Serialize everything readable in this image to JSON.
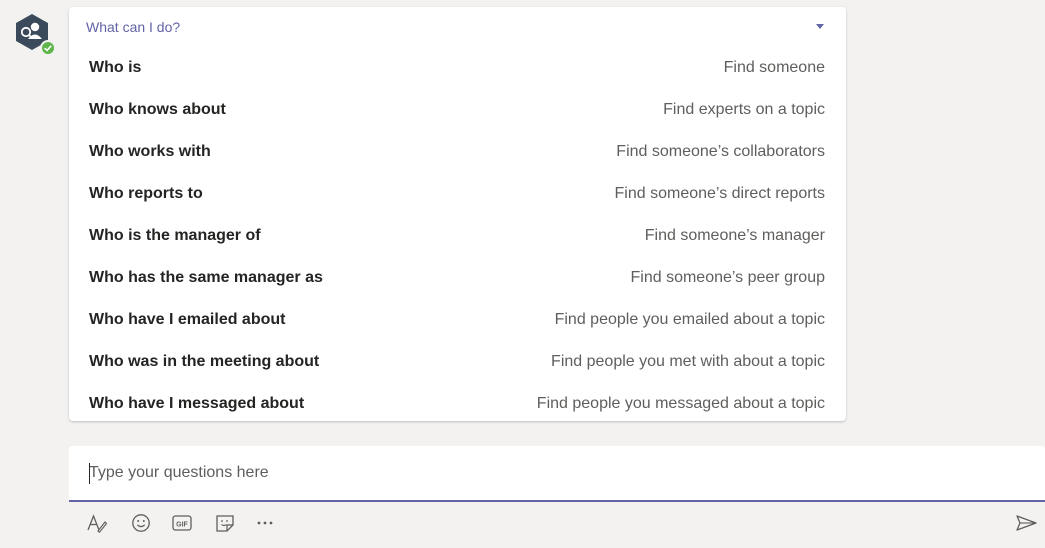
{
  "bot": {
    "avatar_icon": "bot-people-icon",
    "status_icon": "available-check-icon",
    "status_color": "#5eb54a"
  },
  "card": {
    "title": "What can I do?",
    "collapse_icon": "chevron-down-icon",
    "commands": [
      {
        "command": "Who is",
        "description": "Find someone"
      },
      {
        "command": "Who knows about",
        "description": "Find experts on a topic"
      },
      {
        "command": "Who works with",
        "description": "Find someone’s collaborators"
      },
      {
        "command": "Who reports to",
        "description": "Find someone’s direct reports"
      },
      {
        "command": "Who is the manager of",
        "description": "Find someone’s manager"
      },
      {
        "command": "Who has the same manager as",
        "description": "Find someone’s peer group"
      },
      {
        "command": "Who have I emailed about",
        "description": "Find people you emailed about a topic"
      },
      {
        "command": "Who was in the meeting about",
        "description": "Find people you met with about a topic"
      },
      {
        "command": "Who have I messaged about",
        "description": "Find people you messaged about a topic"
      }
    ]
  },
  "composer": {
    "placeholder": "Type your questions here",
    "value": ""
  },
  "toolbar": {
    "icons": [
      "format-icon",
      "emoji-icon",
      "gif-icon",
      "sticker-icon",
      "more-options-icon"
    ],
    "gif_label": "GIF",
    "send_icon": "send-icon"
  },
  "colors": {
    "accent": "#6264a7",
    "background": "#f3f2f1",
    "text_primary": "#252423",
    "text_secondary": "#605e5c"
  }
}
